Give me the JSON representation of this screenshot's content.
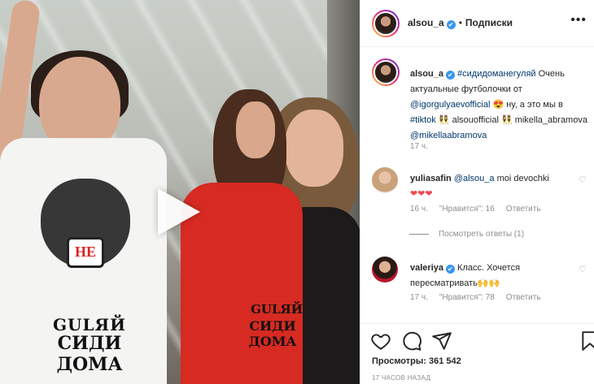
{
  "post": {
    "author": "alsou_a",
    "verified_mark": "✔",
    "follow_label": "Подписки",
    "more_label": "•••",
    "separator": "•"
  },
  "video": {
    "shirt_main_line1": "GULЯЙ",
    "shirt_main_line2": "СИДИ ДОМА",
    "shirt_logo": "НЕ",
    "shirt_red_line1": "GULЯЙ",
    "shirt_red_line2": "СИДИ ДОМА",
    "play_icon": "play-icon"
  },
  "caption": {
    "author": "alsou_a",
    "hashtag1": "#сидидоманегуляй",
    "text1": " Очень актуальные футболочки от ",
    "mention1": "@igorgulyaevofficial",
    "text2": " 😍 ну, а это мы в ",
    "hashtag2": "#tiktok",
    "text3": " 👯‍♀️ alsouofficial 👯‍♀️ mikella_abramova ",
    "mention2": "@mikellaabramova",
    "time": "17 ч."
  },
  "comments": [
    {
      "author": "yuliasafin",
      "mention": "@alsou_a",
      "text": " moi devochki",
      "text2": "❤❤❤",
      "time": "16 ч.",
      "likes": "\"Нравится\": 16",
      "reply": "Ответить",
      "view_replies": "Посмотреть ответы (1)"
    },
    {
      "author": "valeriya",
      "text": " Класс. Хочется пересматривать🙌🙌",
      "time": "17 ч.",
      "likes": "\"Нравится\": 78",
      "reply": "Ответить"
    }
  ],
  "stats": {
    "views_label": "Просмотры: ",
    "views_value": "361 542",
    "posted_ago": "17 ЧАСОВ НАЗАД"
  },
  "colors": {
    "link": "#00376b",
    "verified": "#3897f0",
    "muted": "#8e8e8e",
    "heart_red": "#ed4956"
  }
}
